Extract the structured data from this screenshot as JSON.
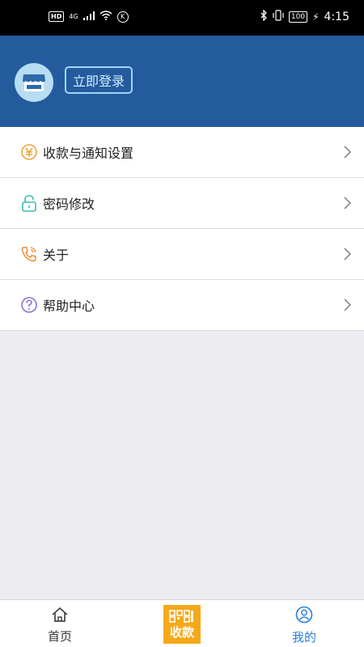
{
  "status_bar": {
    "left": {
      "hd": "HD",
      "network": "4G"
    },
    "battery": "100",
    "time": "4:15"
  },
  "header": {
    "login_button": "立即登录"
  },
  "menu": {
    "items": [
      {
        "label": "收款与通知设置",
        "icon": "yen-coin-icon"
      },
      {
        "label": "密码修改",
        "icon": "lock-icon"
      },
      {
        "label": "关于",
        "icon": "phone-icon"
      },
      {
        "label": "帮助中心",
        "icon": "question-icon"
      }
    ]
  },
  "tabbar": {
    "home": "首页",
    "scan": "收款",
    "mine": "我的"
  },
  "colors": {
    "header_bg": "#245b9d",
    "scan_bg": "#f5a91a",
    "active_tab": "#2b7fd6"
  }
}
